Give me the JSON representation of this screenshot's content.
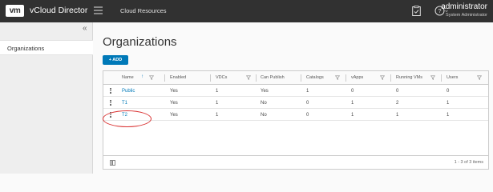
{
  "header": {
    "logo_text": "vm",
    "app_title": "vCloud Director",
    "nav_link": "Cloud Resources",
    "user_name": "administrator",
    "user_role": "System Administrator"
  },
  "sidebar": {
    "collapse_glyph": "«",
    "items": [
      {
        "label": "Organizations",
        "active": true
      }
    ]
  },
  "main": {
    "title": "Organizations",
    "add_label": "+ ADD"
  },
  "grid": {
    "columns": [
      "Name",
      "Enabled",
      "VDCs",
      "Can Publish",
      "Catalogs",
      "vApps",
      "Running VMs",
      "Users"
    ],
    "sort_column": "Name",
    "sort_direction": "ascending",
    "rows": [
      [
        "Public",
        "Yes",
        "1",
        "Yes",
        "1",
        "0",
        "0",
        "0"
      ],
      [
        "T1",
        "Yes",
        "1",
        "No",
        "0",
        "1",
        "2",
        "1"
      ],
      [
        "T2",
        "Yes",
        "1",
        "No",
        "0",
        "1",
        "1",
        "1"
      ]
    ],
    "footer_count": "1 - 3 of 3 items"
  },
  "colors": {
    "topbar": "#313131",
    "accent": "#0079b8",
    "highlight_annotation": "#d93030"
  },
  "icons": [
    "menu-icon",
    "clipboard-icon",
    "help-icon",
    "collapse-icon",
    "filter-icon",
    "row-actions-icon",
    "column-toggle-icon"
  ]
}
